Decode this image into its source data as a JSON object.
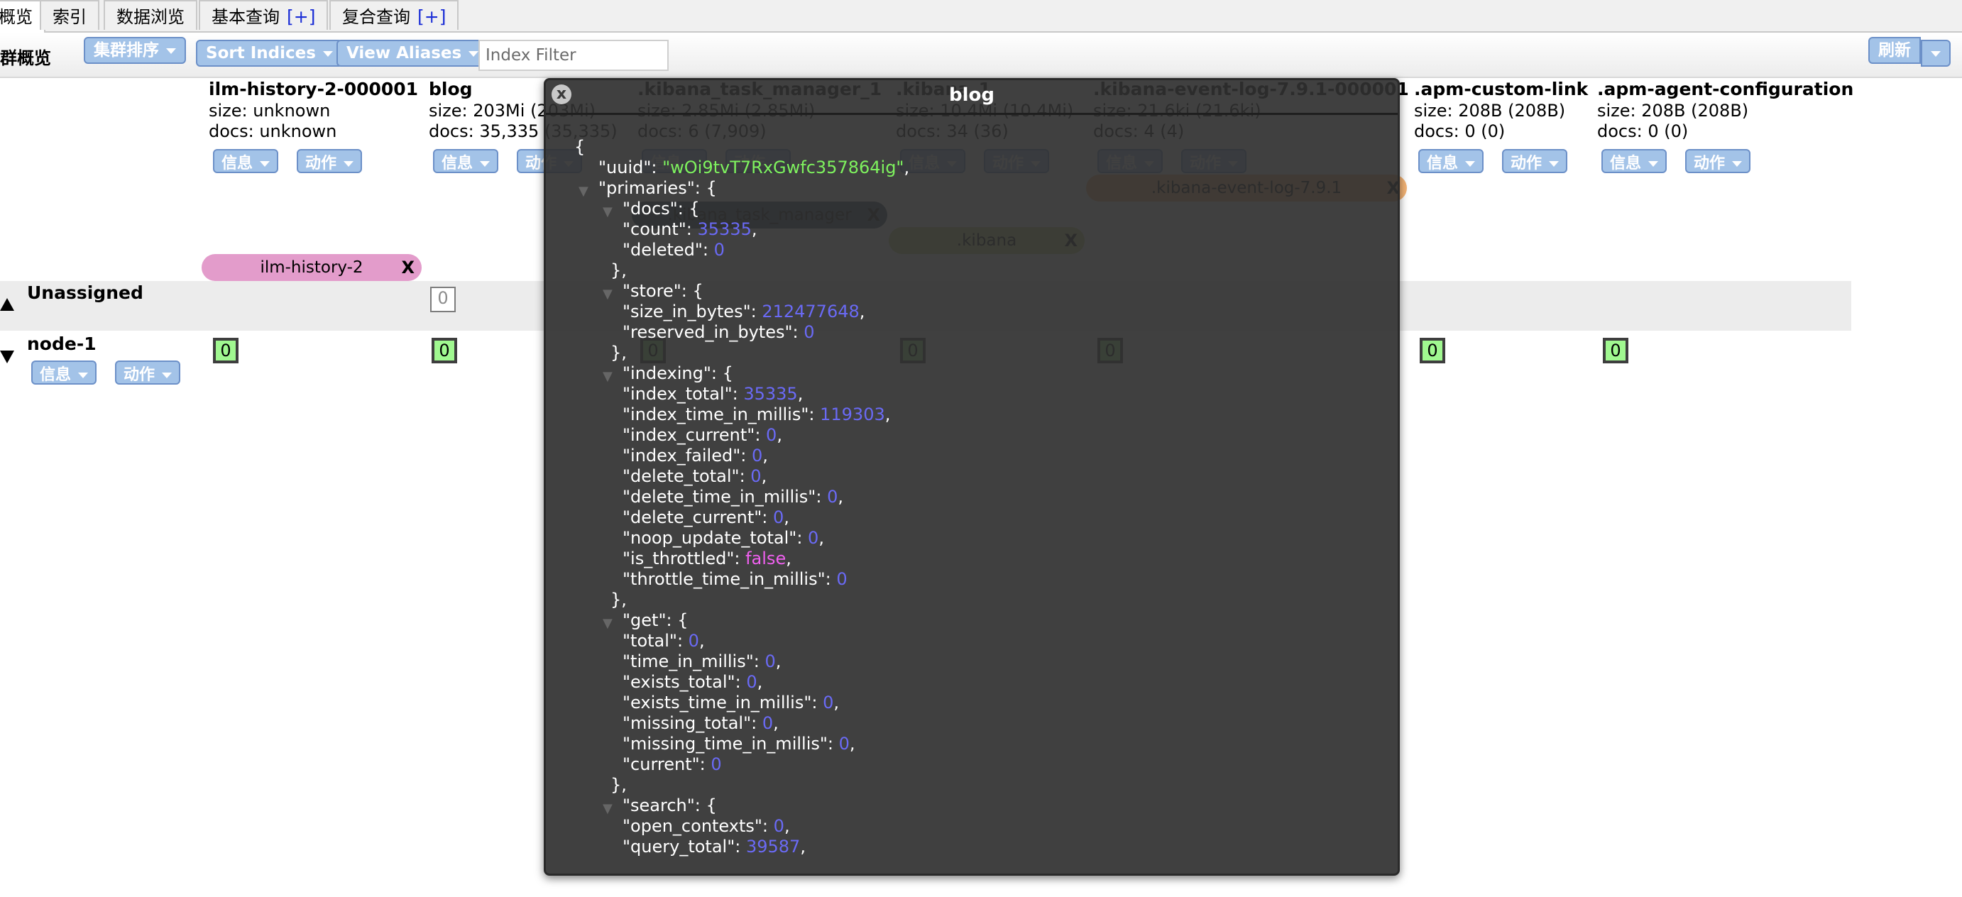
{
  "tabs": [
    {
      "label": "概览",
      "active": true
    },
    {
      "label": "索引"
    },
    {
      "label": "数据浏览"
    },
    {
      "label": "基本查询",
      "plus": "[+]"
    },
    {
      "label": "复合查询",
      "plus": "[+]"
    }
  ],
  "toolbar": {
    "title": "群概览",
    "cluster_sort": "集群排序",
    "sort_indices": "Sort Indices",
    "view_aliases": "View Aliases",
    "filter_placeholder": "Index Filter",
    "refresh": "刷新"
  },
  "buttons": {
    "info": "信息",
    "action": "动作"
  },
  "indices": [
    {
      "name": "ilm-history-2-000001",
      "size": "size: unknown",
      "docs": "docs: unknown"
    },
    {
      "name": "blog",
      "size": "size: 203Mi (203Mi)",
      "docs": "docs: 35,335 (35,335)"
    },
    {
      "name": ".kibana_task_manager_1",
      "size": "size: 2.85Mi (2.85Mi)",
      "docs": "docs: 6 (7,909)"
    },
    {
      "name": ".kibana_1",
      "size": "size: 10.4Mi (10.4Mi)",
      "docs": "docs: 34 (36)"
    },
    {
      "name": ".kibana-event-log-7.9.1-000001",
      "size": "size: 21.6ki (21.6ki)",
      "docs": "docs: 4 (4)"
    },
    {
      "name": ".apm-custom-link",
      "size": "size: 208B (208B)",
      "docs": "docs: 0 (0)"
    },
    {
      "name": ".apm-agent-configuration",
      "size": "size: 208B (208B)",
      "docs": "docs: 0 (0)"
    }
  ],
  "aliases": [
    {
      "label": "ilm-history-2",
      "close": "X",
      "color": "#e39ccb"
    },
    {
      "label": ".kibana_task_manager",
      "close": "X",
      "color": "#3c4f66"
    },
    {
      "label": ".kibana",
      "close": "X",
      "color": "#c4d87c"
    },
    {
      "label": ".kibana-event-log-7.9.1",
      "close": "X",
      "color": "#f4b476"
    }
  ],
  "rows": {
    "unassigned": {
      "label": "Unassigned",
      "shard": "0"
    },
    "node": {
      "label": "node-1",
      "shards": [
        "0",
        "0",
        "0",
        "0",
        "0",
        "0",
        "0"
      ]
    }
  },
  "popup": {
    "title": "blog",
    "close": "x",
    "json_lines": [
      {
        "indent": 0,
        "text": "{"
      },
      {
        "indent": 1,
        "key": "\"uuid\": ",
        "val": "\"wOi9tvT7RxGwfc357864ig\"",
        "type": "str",
        "tail": ","
      },
      {
        "indent": 1,
        "tri": true,
        "key": "\"primaries\": {"
      },
      {
        "indent": 2,
        "tri": true,
        "key": "\"docs\": {"
      },
      {
        "indent": 2,
        "key": "\"count\": ",
        "val": "35335",
        "type": "num",
        "tail": ","
      },
      {
        "indent": 2,
        "key": "\"deleted\": ",
        "val": "0",
        "type": "num"
      },
      {
        "indent": 1.5,
        "text": "},"
      },
      {
        "indent": 2,
        "tri": true,
        "key": "\"store\": {"
      },
      {
        "indent": 2,
        "key": "\"size_in_bytes\": ",
        "val": "212477648",
        "type": "num",
        "tail": ","
      },
      {
        "indent": 2,
        "key": "\"reserved_in_bytes\": ",
        "val": "0",
        "type": "num"
      },
      {
        "indent": 1.5,
        "text": "},"
      },
      {
        "indent": 2,
        "tri": true,
        "key": "\"indexing\": {"
      },
      {
        "indent": 2,
        "key": "\"index_total\": ",
        "val": "35335",
        "type": "num",
        "tail": ","
      },
      {
        "indent": 2,
        "key": "\"index_time_in_millis\": ",
        "val": "119303",
        "type": "num",
        "tail": ","
      },
      {
        "indent": 2,
        "key": "\"index_current\": ",
        "val": "0",
        "type": "num",
        "tail": ","
      },
      {
        "indent": 2,
        "key": "\"index_failed\": ",
        "val": "0",
        "type": "num",
        "tail": ","
      },
      {
        "indent": 2,
        "key": "\"delete_total\": ",
        "val": "0",
        "type": "num",
        "tail": ","
      },
      {
        "indent": 2,
        "key": "\"delete_time_in_millis\": ",
        "val": "0",
        "type": "num",
        "tail": ","
      },
      {
        "indent": 2,
        "key": "\"delete_current\": ",
        "val": "0",
        "type": "num",
        "tail": ","
      },
      {
        "indent": 2,
        "key": "\"noop_update_total\": ",
        "val": "0",
        "type": "num",
        "tail": ","
      },
      {
        "indent": 2,
        "key": "\"is_throttled\": ",
        "val": "false",
        "type": "bool",
        "tail": ","
      },
      {
        "indent": 2,
        "key": "\"throttle_time_in_millis\": ",
        "val": "0",
        "type": "num"
      },
      {
        "indent": 1.5,
        "text": "},"
      },
      {
        "indent": 2,
        "tri": true,
        "key": "\"get\": {"
      },
      {
        "indent": 2,
        "key": "\"total\": ",
        "val": "0",
        "type": "num",
        "tail": ","
      },
      {
        "indent": 2,
        "key": "\"time_in_millis\": ",
        "val": "0",
        "type": "num",
        "tail": ","
      },
      {
        "indent": 2,
        "key": "\"exists_total\": ",
        "val": "0",
        "type": "num",
        "tail": ","
      },
      {
        "indent": 2,
        "key": "\"exists_time_in_millis\": ",
        "val": "0",
        "type": "num",
        "tail": ","
      },
      {
        "indent": 2,
        "key": "\"missing_total\": ",
        "val": "0",
        "type": "num",
        "tail": ","
      },
      {
        "indent": 2,
        "key": "\"missing_time_in_millis\": ",
        "val": "0",
        "type": "num",
        "tail": ","
      },
      {
        "indent": 2,
        "key": "\"current\": ",
        "val": "0",
        "type": "num"
      },
      {
        "indent": 1.5,
        "text": "},"
      },
      {
        "indent": 2,
        "tri": true,
        "key": "\"search\": {"
      },
      {
        "indent": 2,
        "key": "\"open_contexts\": ",
        "val": "0",
        "type": "num",
        "tail": ","
      },
      {
        "indent": 2,
        "key": "\"query_total\": ",
        "val": "39587",
        "type": "num",
        "tail": ","
      }
    ]
  }
}
